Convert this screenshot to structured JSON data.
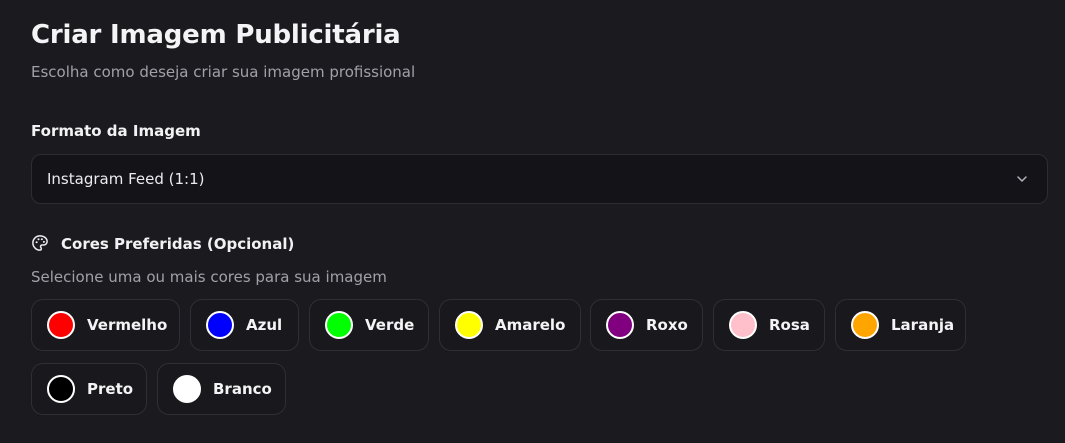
{
  "header": {
    "title": "Criar Imagem Publicitária",
    "subtitle": "Escolha como deseja criar sua imagem profissional"
  },
  "format": {
    "label": "Formato da Imagem",
    "selected": "Instagram Feed (1:1)",
    "icon": "chevron-down-icon"
  },
  "colors": {
    "icon": "palette-icon",
    "label": "Cores Preferidas (Opcional)",
    "hint": "Selecione uma ou mais cores para sua imagem",
    "options": [
      {
        "label": "Vermelho",
        "color": "#ff0000"
      },
      {
        "label": "Azul",
        "color": "#0000ff"
      },
      {
        "label": "Verde",
        "color": "#00ff00"
      },
      {
        "label": "Amarelo",
        "color": "#ffff00"
      },
      {
        "label": "Roxo",
        "color": "#800080"
      },
      {
        "label": "Rosa",
        "color": "#ffc0cb"
      },
      {
        "label": "Laranja",
        "color": "#ffa500"
      },
      {
        "label": "Preto",
        "color": "#000000"
      },
      {
        "label": "Branco",
        "color": "#ffffff"
      }
    ]
  }
}
